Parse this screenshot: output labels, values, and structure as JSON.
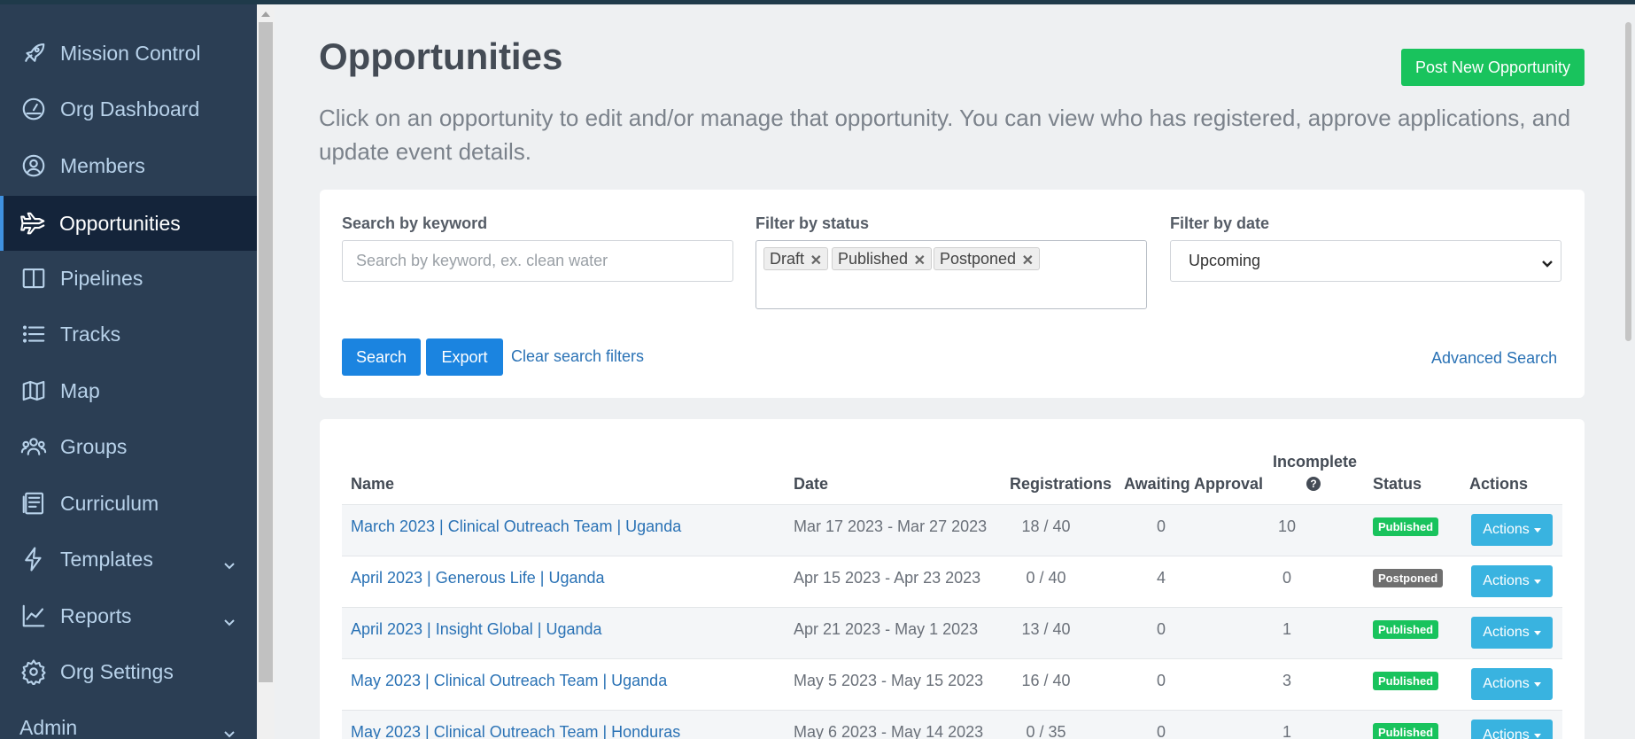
{
  "sidebar": {
    "items": [
      {
        "label": "Mission Control",
        "icon": "rocket-icon"
      },
      {
        "label": "Org Dashboard",
        "icon": "gauge-icon"
      },
      {
        "label": "Members",
        "icon": "user-circle-icon"
      },
      {
        "label": "Opportunities",
        "icon": "plane-icon",
        "active": true
      },
      {
        "label": "Pipelines",
        "icon": "columns-icon"
      },
      {
        "label": "Tracks",
        "icon": "list-icon"
      },
      {
        "label": "Map",
        "icon": "map-icon"
      },
      {
        "label": "Groups",
        "icon": "users-icon"
      },
      {
        "label": "Curriculum",
        "icon": "book-icon"
      },
      {
        "label": "Templates",
        "icon": "bolt-icon",
        "has_submenu": true
      },
      {
        "label": "Reports",
        "icon": "chart-line-icon",
        "has_submenu": true
      },
      {
        "label": "Org Settings",
        "icon": "gear-icon"
      },
      {
        "label": "Admin",
        "has_submenu": true
      }
    ]
  },
  "header": {
    "title": "Opportunities",
    "description": "Click on an opportunity to edit and/or manage that opportunity. You can view who has registered, approve applications, and update event details.",
    "post_button": "Post New Opportunity"
  },
  "filters": {
    "keyword_label": "Search by keyword",
    "keyword_placeholder": "Search by keyword, ex. clean water",
    "keyword_value": "",
    "status_label": "Filter by status",
    "status_tags": [
      "Draft",
      "Published",
      "Postponed"
    ],
    "date_label": "Filter by date",
    "date_value": "Upcoming",
    "search_button": "Search",
    "export_button": "Export",
    "clear_link": "Clear search filters",
    "advanced_link": "Advanced Search"
  },
  "table": {
    "columns": {
      "name": "Name",
      "date": "Date",
      "registrations": "Registrations",
      "awaiting": "Awaiting Approval",
      "incomplete": "Incomplete",
      "status": "Status",
      "actions": "Actions"
    },
    "help_icon": "question-circle-icon",
    "rows": [
      {
        "name": "March 2023 | Clinical Outreach Team | Uganda",
        "date": "Mar 17 2023 - Mar 27 2023",
        "registrations": "18 / 40",
        "awaiting": "0",
        "incomplete": "10",
        "status": "Published",
        "status_color": "#19c35d",
        "action": "Actions"
      },
      {
        "name": "April 2023 | Generous Life | Uganda",
        "date": "Apr 15 2023 - Apr 23 2023",
        "registrations": "0 / 40",
        "awaiting": "4",
        "incomplete": "0",
        "status": "Postponed",
        "status_color": "#6f6f6f",
        "action": "Actions"
      },
      {
        "name": "April 2023 | Insight Global | Uganda",
        "date": "Apr 21 2023 - May 1 2023",
        "registrations": "13 / 40",
        "awaiting": "0",
        "incomplete": "1",
        "status": "Published",
        "status_color": "#19c35d",
        "action": "Actions"
      },
      {
        "name": "May 2023 | Clinical Outreach Team | Uganda",
        "date": "May 5 2023 - May 15 2023",
        "registrations": "16 / 40",
        "awaiting": "0",
        "incomplete": "3",
        "status": "Published",
        "status_color": "#19c35d",
        "action": "Actions"
      },
      {
        "name": "May 2023 | Clinical Outreach Team | Honduras",
        "date": "May 6 2023 - May 14 2023",
        "registrations": "0 / 35",
        "awaiting": "0",
        "incomplete": "1",
        "status": "Published",
        "status_color": "#19c35d",
        "action": "Actions"
      }
    ]
  }
}
